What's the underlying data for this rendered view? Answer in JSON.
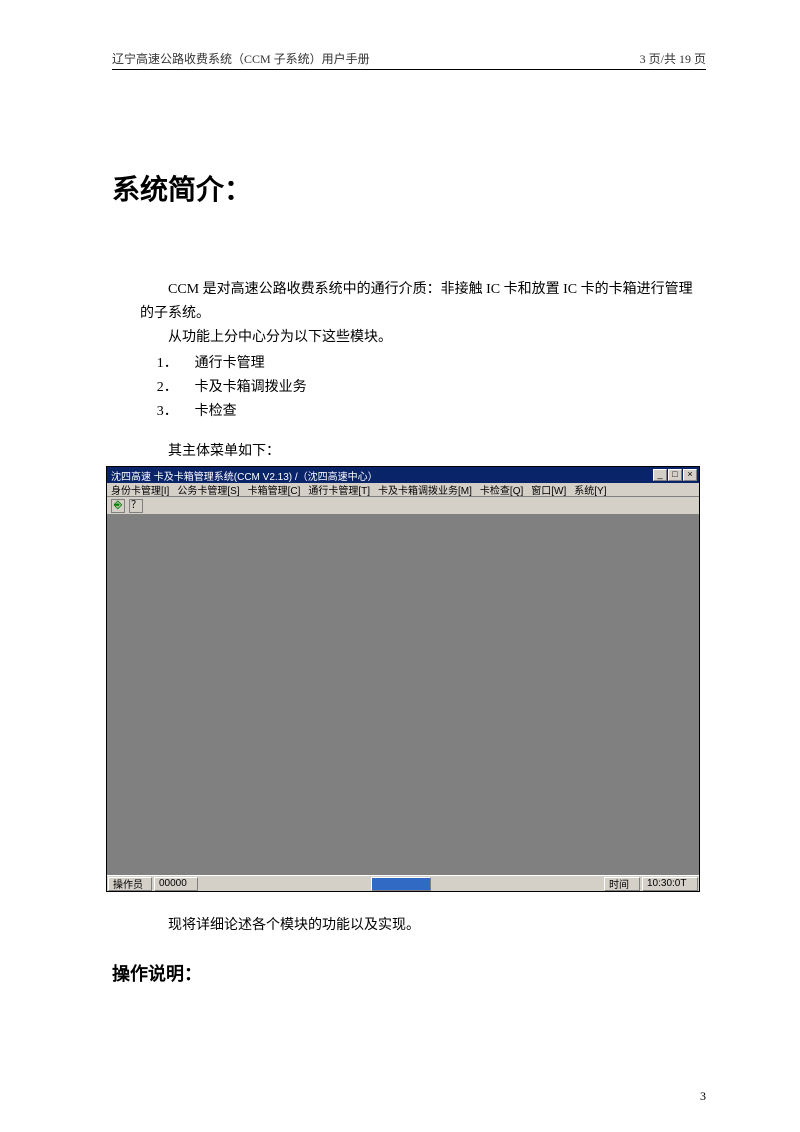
{
  "header": {
    "left": "辽宁高速公路收费系统（CCM 子系统）用户手册",
    "right": "3 页/共 19 页"
  },
  "headings": {
    "main": "系统简介：",
    "sub": "操作说明："
  },
  "body": {
    "para1": "CCM 是对高速公路收费系统中的通行介质：非接触 IC 卡和放置 IC 卡的卡箱进行管理的子系统。",
    "para2": "从功能上分中心分为以下这些模块。",
    "modules": [
      {
        "num": "1．",
        "label": "通行卡管理"
      },
      {
        "num": "2．",
        "label": "卡及卡箱调拨业务"
      },
      {
        "num": "3．",
        "label": "卡检查"
      }
    ],
    "before_screenshot": "其主体菜单如下：",
    "after_screenshot": "现将详细论述各个模块的功能以及实现。"
  },
  "app": {
    "title": "沈四高速 卡及卡箱管理系统(CCM V2.13) /（沈四高速中心）",
    "menu": [
      "身份卡管理[I]",
      "公务卡管理[S]",
      "卡箱管理[C]",
      "通行卡管理[T]",
      "卡及卡箱调拨业务[M]",
      "卡检查[Q]",
      "窗口[W]",
      "系统[Y]"
    ],
    "win_controls": {
      "min": "_",
      "max": "□",
      "close": "×"
    },
    "toolbar": {
      "exit": "⎆",
      "help": "？"
    },
    "status": {
      "operator_label": "操作员",
      "operator_id": "00000",
      "time_label": "时间",
      "time_value": "10:30:0T"
    }
  },
  "page_number": "3"
}
